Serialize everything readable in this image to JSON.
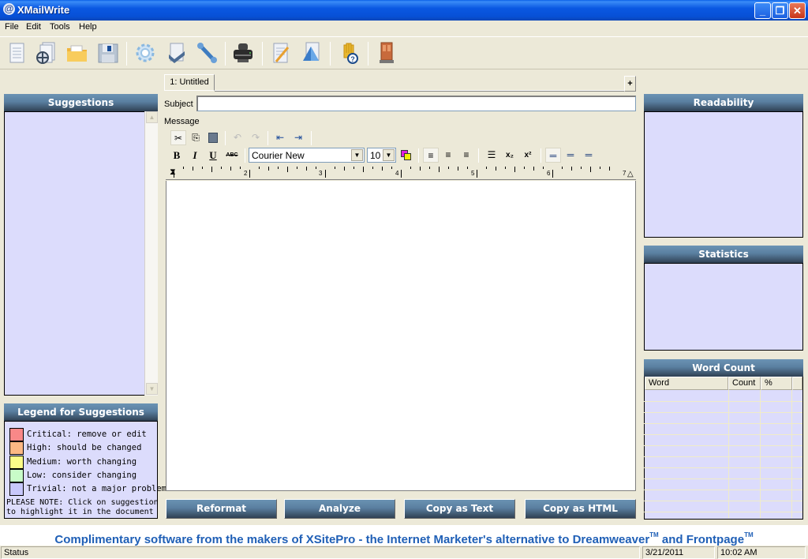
{
  "window": {
    "title": "XMailWrite",
    "app_icon": "@",
    "controls": {
      "minimize": "_",
      "restore": "❐",
      "close": "✕"
    }
  },
  "menu": [
    "File",
    "Edit",
    "Tools",
    "Help"
  ],
  "toolbar": {
    "buttons": [
      {
        "name": "new-document-icon"
      },
      {
        "name": "open-template-icon"
      },
      {
        "name": "open-folder-icon"
      },
      {
        "name": "save-disk-icon"
      },
      {
        "name": "settings-gear-icon"
      },
      {
        "name": "check-document-icon"
      },
      {
        "name": "tools-wrench-icon"
      },
      {
        "name": "printer-icon"
      },
      {
        "name": "edit-document-icon"
      },
      {
        "name": "document-shape-icon"
      },
      {
        "name": "help-hand-icon"
      },
      {
        "name": "exit-door-icon"
      }
    ]
  },
  "suggestions": {
    "title": "Suggestions",
    "items": []
  },
  "legend": {
    "title": "Legend for Suggestions",
    "items": [
      {
        "label": "Critical: remove or edit",
        "color": "#f98888"
      },
      {
        "label": "High: should be changed",
        "color": "#fcb884"
      },
      {
        "label": "Medium: worth changing",
        "color": "#fcfc88"
      },
      {
        "label": "Low: consider changing",
        "color": "#c8fcc8"
      },
      {
        "label": "Trivial: not a major problem",
        "color": "#c8c8fc"
      }
    ],
    "note_line1": "PLEASE NOTE: Click on suggestion",
    "note_line2": "to highlight it in the document"
  },
  "editor": {
    "tabs": [
      {
        "label": "1: Untitled"
      }
    ],
    "add_tab": "+",
    "subject_label": "Subject",
    "subject_value": "",
    "message_label": "Message",
    "font_family": "Courier New",
    "font_size": "10",
    "ruler_numbers": [
      "2",
      "3",
      "4",
      "5",
      "6",
      "7"
    ],
    "body": ""
  },
  "format_toolbar": {
    "cut": "✂",
    "copy": "⎘",
    "paste": "📋",
    "undo": "↶",
    "redo": "↷",
    "outdent": "⇤",
    "indent": "⇥",
    "bold": "B",
    "italic": "I",
    "underline": "U",
    "strike": "ABC",
    "subscript": "x₂",
    "superscript": "x²"
  },
  "actions": {
    "reformat": "Reformat",
    "analyze": "Analyze",
    "copy_text": "Copy as Text",
    "copy_html": "Copy as HTML"
  },
  "readability": {
    "title": "Readability"
  },
  "statistics": {
    "title": "Statistics"
  },
  "word_count": {
    "title": "Word Count",
    "columns": [
      "Word",
      "Count",
      "%"
    ],
    "rows": []
  },
  "promo": {
    "text_before": "Complimentary software from the makers of XSitePro - the Internet Marketer's alternative to Dreamweaver",
    "tm": "TM",
    "text_mid": " and Frontpage",
    "tm2": "TM"
  },
  "status": {
    "text": "Status",
    "date": "3/21/2011",
    "time": "10:02 AM"
  },
  "colors": {
    "panel_body": "#dcdcfc",
    "panel_head": "#5a7fa0",
    "promo": "#1f5fb6",
    "titlebar": "#0a58e2"
  }
}
